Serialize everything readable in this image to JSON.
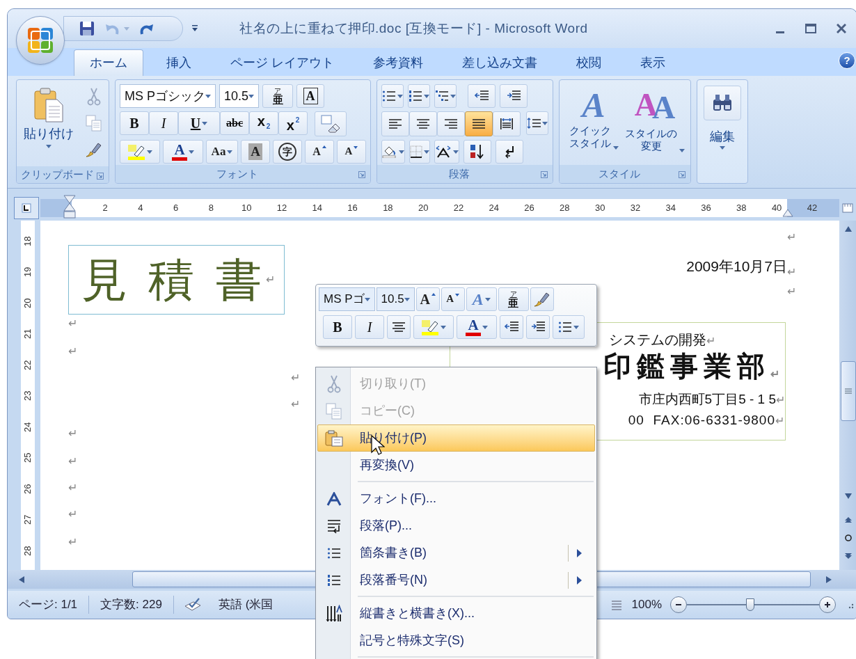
{
  "title_bar": {
    "title": "社名の上に重ねて押印.doc [互換モード] - Microsoft Word",
    "undo_enabled": false
  },
  "ribbon_tabs": [
    {
      "label": "ホーム",
      "selected": true
    },
    {
      "label": "挿入",
      "selected": false
    },
    {
      "label": "ページ レイアウト",
      "selected": false
    },
    {
      "label": "参考資料",
      "selected": false
    },
    {
      "label": "差し込み文書",
      "selected": false
    },
    {
      "label": "校閲",
      "selected": false
    },
    {
      "label": "表示",
      "selected": false
    }
  ],
  "help_button": {
    "glyph": "?"
  },
  "clipboard_group": {
    "paste_label": "貼り付け",
    "label": "クリップボード",
    "cut_enabled": false,
    "copy_enabled": false
  },
  "font_group": {
    "font_name": "MS Pゴシック",
    "font_size": "10.5",
    "label": "フォント",
    "row_1": [
      {
        "kind": "ruby",
        "glyph": "亜",
        "ruby": "ア"
      },
      {
        "kind": "boxed",
        "glyph": "A"
      }
    ],
    "row_2": [
      {
        "kind": "bold",
        "glyph": "B"
      },
      {
        "kind": "italic",
        "glyph": "I"
      },
      {
        "kind": "underline",
        "glyph": "U"
      },
      {
        "kind": "strike",
        "glyph": "abc"
      },
      {
        "kind": "sub",
        "glyph": "x",
        "index": "2"
      },
      {
        "kind": "sup",
        "glyph": "x",
        "index": "2"
      },
      {
        "kind": "clear"
      }
    ],
    "row_3": [
      {
        "kind": "highlight"
      },
      {
        "kind": "color",
        "glyph": "A"
      },
      {
        "kind": "case",
        "glyph": "Aa"
      },
      {
        "kind": "shade",
        "glyph": "A"
      },
      {
        "kind": "enclose",
        "glyph": "字"
      },
      {
        "kind": "grow",
        "glyph": "A"
      },
      {
        "kind": "shrink",
        "glyph": "A"
      }
    ]
  },
  "paragraph_group": {
    "label": "段落",
    "alignment": [
      {
        "selected": false
      },
      {
        "selected": false
      },
      {
        "selected": false
      },
      {
        "selected": true
      },
      {
        "selected": false
      }
    ]
  },
  "styles_group": {
    "label": "スタイル",
    "quick_styles": {
      "glyph": "A",
      "label_lines": [
        "クイック",
        "スタイル"
      ]
    },
    "change_styles": {
      "glyphs": [
        "A",
        "A"
      ],
      "label_lines": [
        "スタイルの",
        "変更"
      ]
    }
  },
  "editing_group": {
    "label": "編集"
  },
  "ruler": {
    "numbers": [
      "2",
      "4",
      "6",
      "8",
      "10",
      "12",
      "14",
      "16",
      "18",
      "20",
      "22",
      "24",
      "26",
      "28",
      "30",
      "32",
      "34",
      "36",
      "38",
      "40",
      "42"
    ]
  },
  "vertical_ruler": {
    "numbers": [
      "18",
      "19",
      "20",
      "21",
      "22",
      "23",
      "24",
      "25",
      "26",
      "27",
      "28"
    ]
  },
  "document": {
    "paragraphs": [
      {
        "kind": "mark",
        "mark": "↵"
      },
      {
        "kind": "heading",
        "text": "見 積 書",
        "mark": "↵"
      },
      {
        "kind": "date",
        "text": "2009年10月7日",
        "mark": "↵"
      },
      {
        "kind": "mark",
        "mark": "↵"
      },
      {
        "kind": "mark",
        "mark": "↵"
      },
      {
        "kind": "mark",
        "mark": "↵"
      },
      {
        "kind": "mark",
        "mark": "↵"
      },
      {
        "kind": "mark",
        "mark": "↵"
      },
      {
        "kind": "mark",
        "mark": "↵"
      },
      {
        "kind": "mark",
        "mark": "↵"
      },
      {
        "kind": "mark",
        "mark": "↵"
      },
      {
        "kind": "mark",
        "mark": "↵"
      },
      {
        "kind": "mark",
        "mark": "↵"
      }
    ],
    "company_box": {
      "lines": [
        {
          "text": "システムの開発",
          "mark": "↵"
        },
        {
          "text": "印鑑事業部",
          "mark": "↵"
        },
        {
          "text": "市庄内西町5丁目5 - 1 5",
          "mark": "↵"
        },
        {
          "text": "00  FAX:06-6331-9800",
          "mark": "↵"
        }
      ]
    }
  },
  "mini_toolbar": {
    "font_name": "MS Pゴ",
    "font_size": "10.5",
    "row_1": [
      {
        "kind": "grow",
        "glyph": "A"
      },
      {
        "kind": "shrink",
        "glyph": "A"
      },
      {
        "kind": "styles",
        "glyph": "A"
      },
      {
        "kind": "ruby",
        "glyph": "亜",
        "ruby": "ア"
      },
      {
        "kind": "painter"
      }
    ],
    "row_2": [
      {
        "kind": "bold",
        "glyph": "B"
      },
      {
        "kind": "italic",
        "glyph": "I"
      },
      {
        "kind": "center"
      },
      {
        "kind": "highlight"
      },
      {
        "kind": "color",
        "glyph": "A"
      },
      {
        "kind": "outdent"
      },
      {
        "kind": "indent"
      },
      {
        "kind": "bullets"
      }
    ]
  },
  "context_menu": {
    "items": [
      {
        "kind": "item",
        "label": "切り取り(T)",
        "disabled": true,
        "selected": false,
        "submenu": false
      },
      {
        "kind": "item",
        "label": "コピー(C)",
        "disabled": true,
        "selected": false,
        "submenu": false
      },
      {
        "kind": "item",
        "label": "貼り付け(P)",
        "disabled": false,
        "selected": true,
        "submenu": false
      },
      {
        "kind": "item",
        "label": "再変換(V)",
        "disabled": false,
        "selected": false,
        "submenu": false
      },
      {
        "kind": "separator"
      },
      {
        "kind": "item",
        "label": "フォント(F)...",
        "disabled": false,
        "selected": false,
        "submenu": false
      },
      {
        "kind": "item",
        "label": "段落(P)...",
        "disabled": false,
        "selected": false,
        "submenu": false
      },
      {
        "kind": "item",
        "label": "箇条書き(B)",
        "disabled": false,
        "selected": false,
        "submenu": true
      },
      {
        "kind": "item",
        "label": "段落番号(N)",
        "disabled": false,
        "selected": false,
        "submenu": true
      },
      {
        "kind": "separator"
      },
      {
        "kind": "item",
        "label": "縦書きと横書き(X)...",
        "disabled": false,
        "selected": false,
        "submenu": false
      },
      {
        "kind": "item",
        "label": "記号と特殊文字(S)",
        "disabled": false,
        "selected": false,
        "submenu": false
      },
      {
        "kind": "separator"
      }
    ]
  },
  "status_bar": {
    "page": "ページ: 1/1",
    "words": "文字数: 229",
    "language": "英語 (米国",
    "zoom": "100%",
    "zoom_slider": {
      "level": 0.48
    }
  }
}
